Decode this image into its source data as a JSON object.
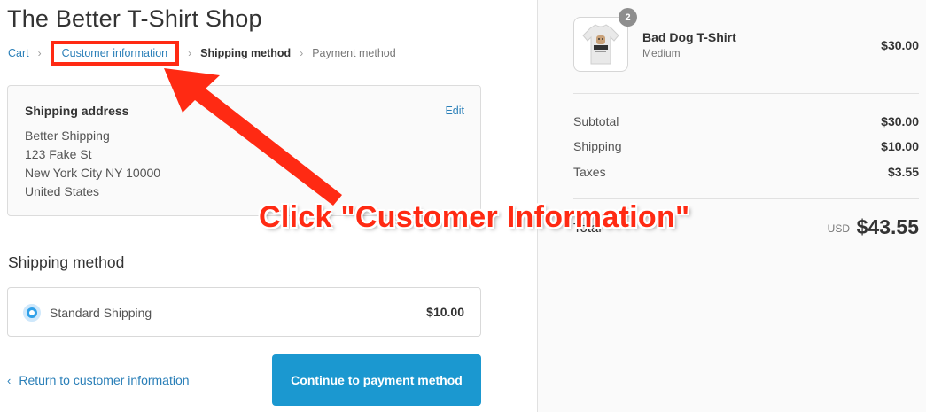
{
  "shop": {
    "title": "The Better T-Shirt Shop"
  },
  "breadcrumb": {
    "cart": "Cart",
    "customer_information": "Customer information",
    "shipping_method": "Shipping method",
    "payment_method": "Payment method",
    "separator": "›"
  },
  "shipping_address": {
    "title": "Shipping address",
    "edit_label": "Edit",
    "lines": [
      "Better Shipping",
      "123 Fake St",
      "New York City NY 10000",
      "United States"
    ]
  },
  "shipping_method": {
    "title": "Shipping method",
    "option_label": "Standard Shipping",
    "option_price": "$10.00",
    "option_selected": true
  },
  "actions": {
    "return_label": "Return to customer information",
    "return_chevron": "‹",
    "continue_label": "Continue to payment method"
  },
  "order": {
    "item": {
      "name": "Bad Dog T-Shirt",
      "variant": "Medium",
      "price": "$30.00",
      "quantity": "2"
    },
    "subtotal_label": "Subtotal",
    "subtotal_value": "$30.00",
    "shipping_label": "Shipping",
    "shipping_value": "$10.00",
    "taxes_label": "Taxes",
    "taxes_value": "$3.55",
    "total_label": "Total",
    "currency": "USD",
    "total_value": "$43.55"
  },
  "annotation": {
    "text": "Click \"Customer Information\"",
    "color": "#ff2a13"
  },
  "colors": {
    "accent": "#1b98d0",
    "link": "#2a7fb8",
    "annotation_red": "#ff2a13"
  }
}
